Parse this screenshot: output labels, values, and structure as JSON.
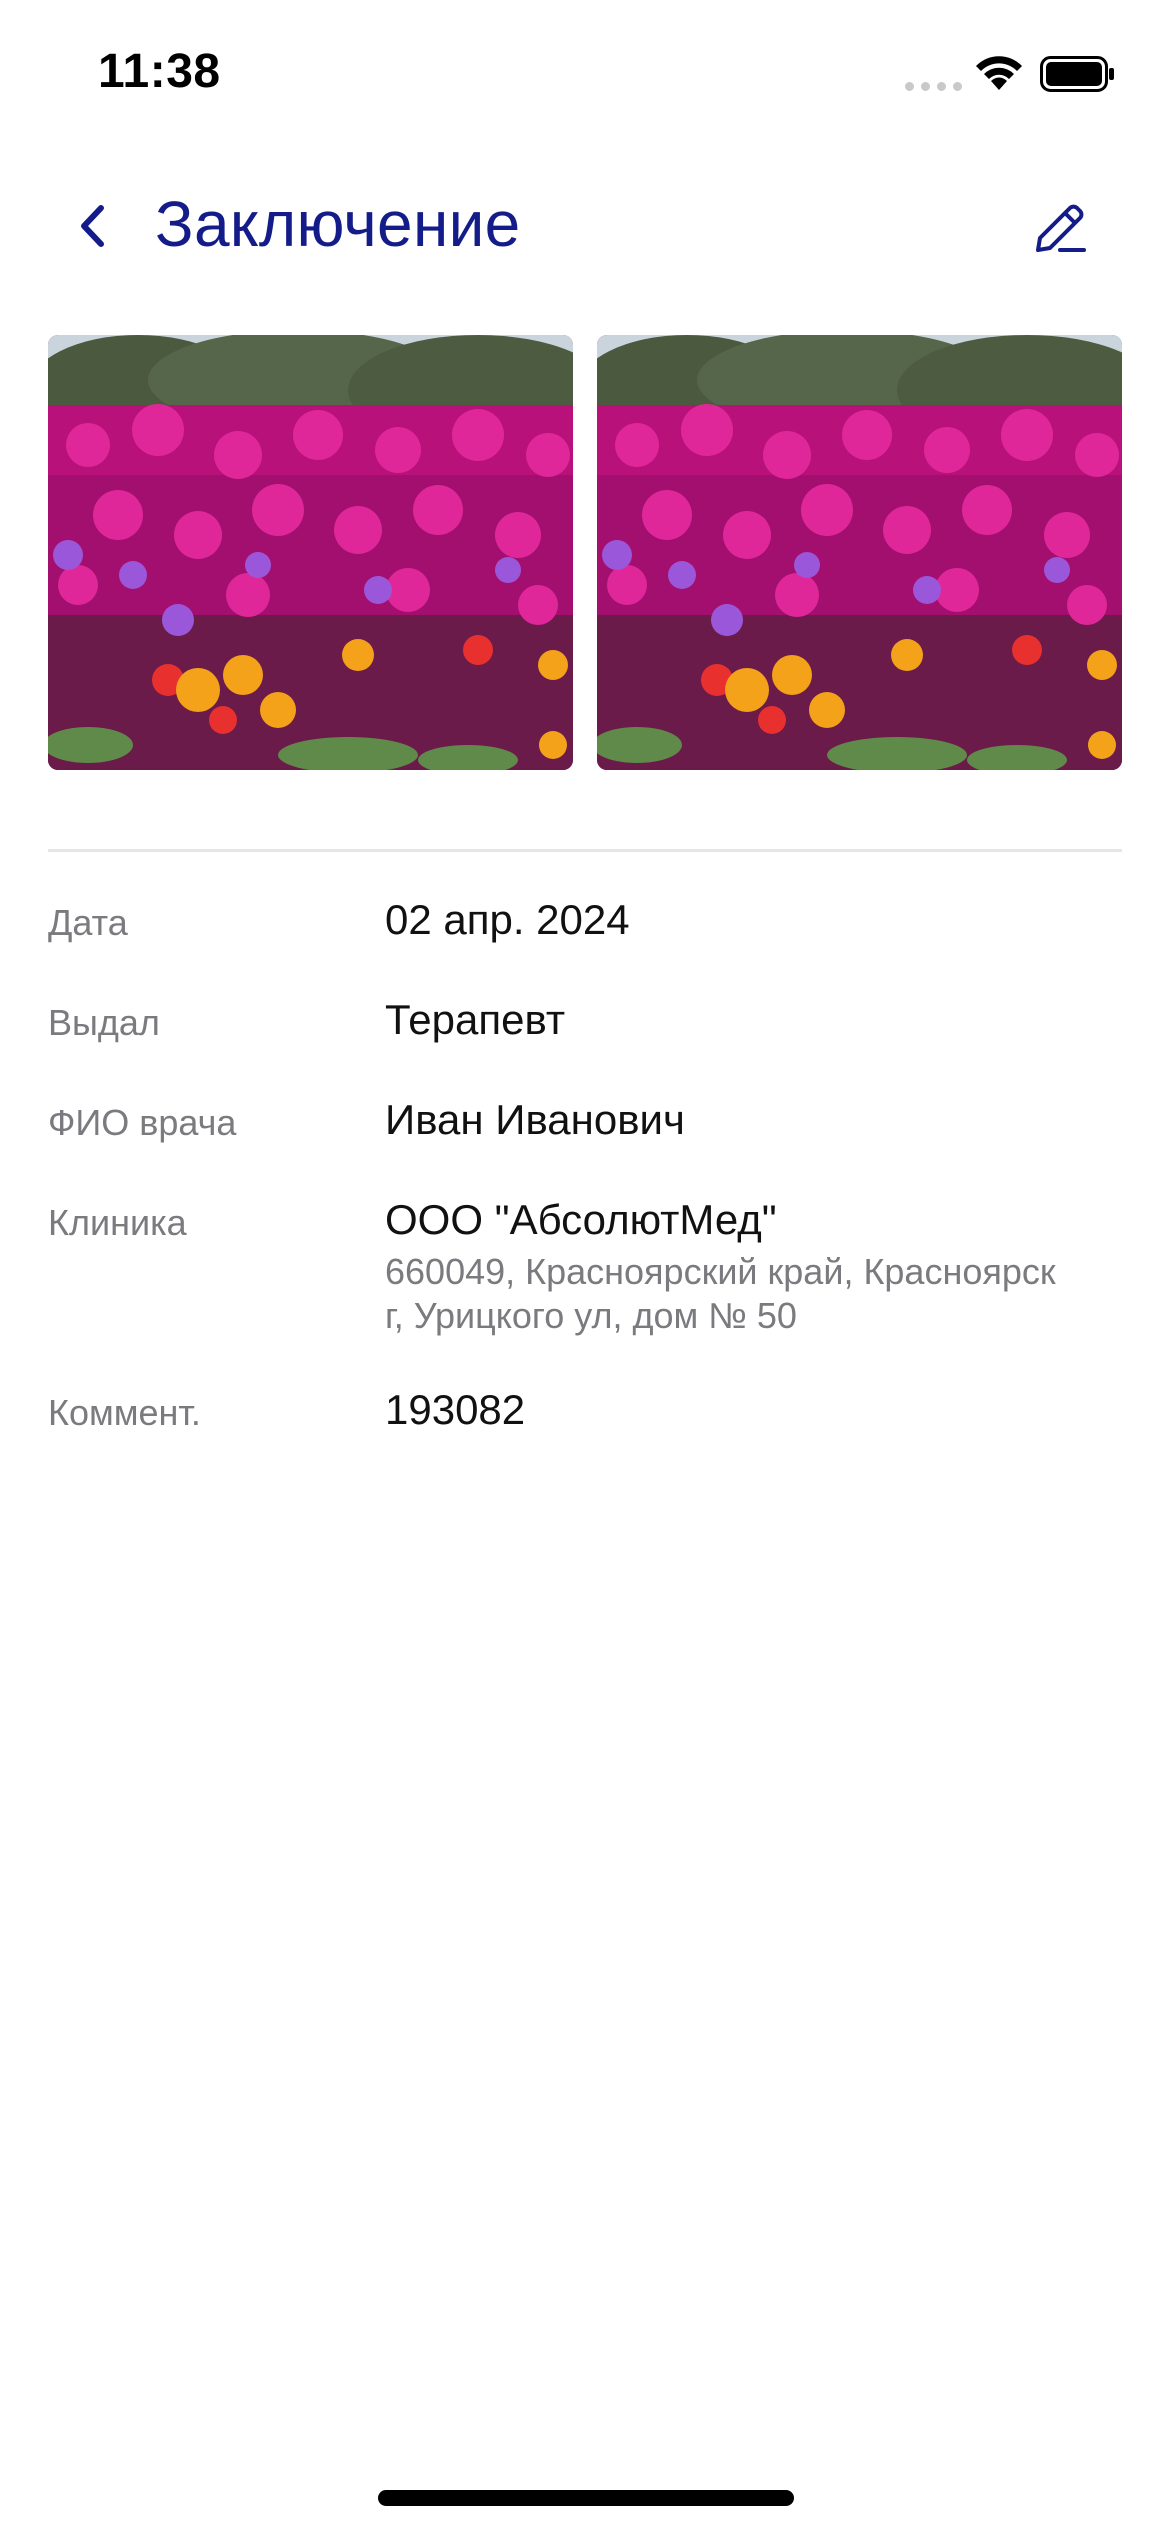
{
  "status_bar": {
    "time": "11:38"
  },
  "header": {
    "title": "Заключение",
    "back_icon": "chevron-left-icon",
    "edit_icon": "pencil-icon",
    "accent_color": "#141c8a"
  },
  "photos": [
    {
      "subject": "flower-field-photo"
    },
    {
      "subject": "flower-field-photo"
    }
  ],
  "details": {
    "date": {
      "label": "Дата",
      "value": "02 апр. 2024"
    },
    "issued_by": {
      "label": "Выдал",
      "value": "Терапевт"
    },
    "doctor": {
      "label": "ФИО врача",
      "value": "Иван Иванович"
    },
    "clinic": {
      "label": "Клиника",
      "value": "ООО \"АбсолютМед\"",
      "address_line1": "660049, Красноярский край, Красноярск",
      "address_line2": "г, Урицкого ул, дом № 50"
    },
    "comment": {
      "label": "Коммент.",
      "value": "193082"
    }
  }
}
